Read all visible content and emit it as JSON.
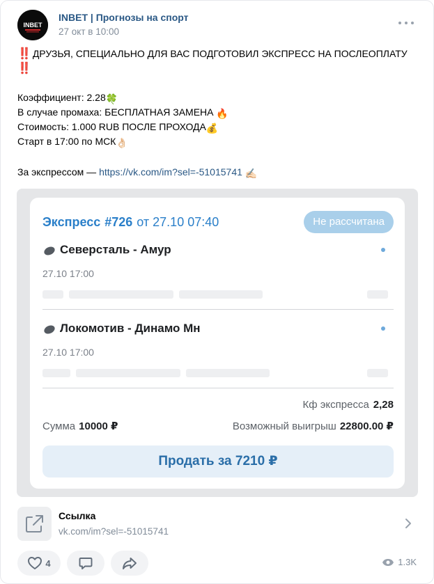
{
  "post": {
    "author": "INBET | Прогнозы на спорт",
    "date": "27 окт в 10:00",
    "avatar_text": "INBET",
    "headline_bang": "‼️",
    "headline": "ДРУЗЬЯ, СПЕЦИАЛЬНО ДЛЯ ВАС ПОДГОТОВИЛ ЭКСПРЕСС НА ПОСЛЕОПЛАТУ",
    "lines": [
      {
        "text": "Коэффициент: 2.28",
        "emoji": "🍀"
      },
      {
        "text": "В случае промаха: БЕСПЛАТНАЯ ЗАМЕНА ",
        "emoji": "🔥"
      },
      {
        "text": "Стоимость: 1.000 RUB ПОСЛЕ ПРОХОДА",
        "emoji": "💰"
      },
      {
        "text": "Старт в 17:00 по МСК",
        "emoji": "👌🏻"
      }
    ],
    "cta_text": "За экспрессом — ",
    "cta_link": "https://vk.com/im?sel=-51015741",
    "cta_emoji": "✍🏻"
  },
  "coupon": {
    "title_word": "Экспресс",
    "number": "#726",
    "date_text": "от 27.10 07:40",
    "status": "Не рассчитана",
    "matches": [
      {
        "name": "Северсталь - Амур",
        "time": "27.10 17:00"
      },
      {
        "name": "Локомотив - Динамо Мн",
        "time": "27.10 17:00"
      }
    ],
    "kf_label": "Кф экспресса",
    "kf_value": "2,28",
    "sum_label": "Сумма",
    "sum_value": "10000 ₽",
    "win_label": "Возможный выигрыш",
    "win_value": "22800.00 ₽",
    "sell_label": "Продать за 7210 ₽"
  },
  "attachment": {
    "title": "Ссылка",
    "url": "vk.com/im?sel=-51015741"
  },
  "actions": {
    "likes": "4",
    "views": "1.3K"
  },
  "colors": {
    "link": "#2a5885",
    "accent_blue": "#2a7fc9",
    "badge": "#a9cfea",
    "bang_red": "#e0211d"
  }
}
